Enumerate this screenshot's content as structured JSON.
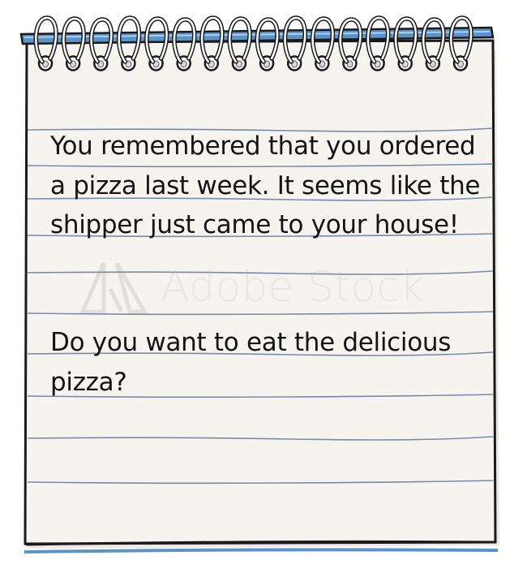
{
  "notepad": {
    "paper_color": "#f6f4ef",
    "line_color": "#7b88ad",
    "binding_color": "#5b93c9",
    "frame_color": "#1a1a1a",
    "ring_count": 16
  },
  "story": {
    "paragraph_1": "You remembered that you ordered a pizza last week. It seems like the shipper just came to your house!",
    "paragraph_2": "Do you want to eat the delicious pizza?"
  },
  "watermark": {
    "text": "Adobe Stock",
    "icon": "adobe-logo-icon"
  }
}
